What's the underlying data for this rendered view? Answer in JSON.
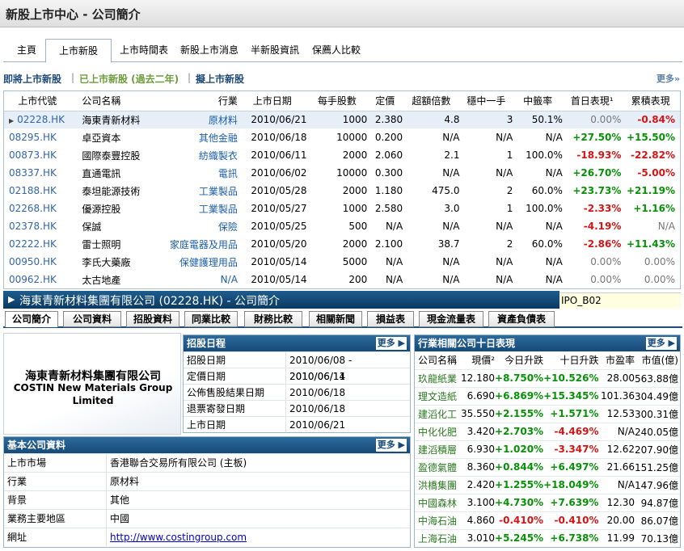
{
  "title": "新股上市中心 - 公司簡介",
  "nav_tabs": [
    "主頁",
    "上市新股",
    "上市時間表",
    "新股上市消息",
    "半新股資訊",
    "保薦人比較"
  ],
  "subnav": {
    "item1": "即將上市新股",
    "sep1": "|",
    "item2": "已上市新股 (過去二年)",
    "sep2": "|",
    "item3": "擬上市新股",
    "more": "更多»"
  },
  "list": {
    "headers": [
      "上市代號",
      "公司名稱",
      "行業",
      "上市日期",
      "每手股數",
      "定價",
      "超額倍數",
      "穩中一手",
      "中籤率",
      "首日表現¹",
      "累積表現"
    ],
    "rows": [
      [
        "02228.HK",
        "海東青新材料",
        "原材料",
        "2010/06/21",
        "1000",
        "2.380",
        "4.8",
        "3",
        "50.1%",
        "0.00%",
        "-0.84%"
      ],
      [
        "08295.HK",
        "卓亞資本",
        "其他金融",
        "2010/06/18",
        "10000",
        "0.200",
        "N/A",
        "N/A",
        "N/A",
        "+27.50%",
        "+15.50%"
      ],
      [
        "00873.HK",
        "國際泰豐控股",
        "紡織製衣",
        "2010/06/11",
        "2000",
        "2.060",
        "2.1",
        "1",
        "100.0%",
        "-18.93%",
        "-22.82%"
      ],
      [
        "08337.HK",
        "直通電訊",
        "電訊",
        "2010/06/02",
        "10000",
        "0.300",
        "N/A",
        "N/A",
        "N/A",
        "+26.70%",
        "-5.00%"
      ],
      [
        "02188.HK",
        "泰坦能源技術",
        "工業製品",
        "2010/05/28",
        "2000",
        "1.180",
        "475.0",
        "2",
        "60.0%",
        "+23.73%",
        "+21.19%"
      ],
      [
        "02268.HK",
        "優源控股",
        "工業製品",
        "2010/05/27",
        "1000",
        "2.580",
        "3.0",
        "1",
        "100.0%",
        "-2.33%",
        "+1.16%"
      ],
      [
        "02378.HK",
        "保誠",
        "保險",
        "2010/05/25",
        "500",
        "N/A",
        "N/A",
        "N/A",
        "N/A",
        "-4.19%",
        "N/A"
      ],
      [
        "02222.HK",
        "雷士照明",
        "家庭電器及用品",
        "2010/05/20",
        "2000",
        "2.100",
        "38.7",
        "2",
        "60.0%",
        "-2.86%",
        "+11.43%"
      ],
      [
        "00950.HK",
        "李氏大藥廠",
        "保健護理用品",
        "2010/05/14",
        "5000",
        "N/A",
        "N/A",
        "N/A",
        "N/A",
        "0.00%",
        "0.00%"
      ],
      [
        "00962.HK",
        "太古地產",
        "N/A",
        "2010/05/14",
        "200",
        "N/A",
        "N/A",
        "N/A",
        "N/A",
        "0.00%",
        "0.00%"
      ]
    ]
  },
  "company_header": {
    "arrow": "▶",
    "title": "海東青新材料集團有限公司 (02228.HK) - 公司簡介",
    "code": "IPO_B02"
  },
  "company_tabs": [
    "公司簡介",
    "公司資料",
    "招股資料",
    "同業比較",
    "財務比較",
    "相關新聞",
    "損益表",
    "現金流量表",
    "資產負債表"
  ],
  "logo": {
    "cn": "海東青新材料集團有限公司",
    "en1": "COSTIN New Materials Group",
    "en2": "Limited"
  },
  "ipo_schedule": {
    "title": "招股日程",
    "more": "更多 ▶",
    "rows": [
      [
        "招股日期",
        "2010/06/08 - 2010/06/11"
      ],
      [
        "定價日期",
        "2010/06/14"
      ],
      [
        "公佈售股結果日期",
        "2010/06/18"
      ],
      [
        "退票寄發日期",
        "2010/06/18"
      ],
      [
        "上市日期",
        "2010/06/21"
      ]
    ]
  },
  "basic_info": {
    "title": "基本公司資料",
    "more": "更多 ▶",
    "rows": [
      [
        "上市市場",
        "香港聯合交易所有限公司 (主板)"
      ],
      [
        "行業",
        "原材料"
      ],
      [
        "背景",
        "其他"
      ],
      [
        "業務主要地區",
        "中國"
      ],
      [
        "網址",
        "http://www.costingroup.com"
      ]
    ]
  },
  "peers": {
    "title": "行業相關公司十日表現",
    "more": "更多 ▶",
    "headers": [
      "公司名稱",
      "現價²",
      "今日升跌",
      "十日升跌",
      "市盈率",
      "市值(億)"
    ],
    "rows": [
      [
        "玖龍紙業",
        "12.180",
        "+8.750%",
        "+10.526%",
        "28.00",
        "563.88億"
      ],
      [
        "理文造紙",
        "6.690",
        "+6.869%",
        "+15.345%",
        "101.36",
        "304.49億"
      ],
      [
        "建滔化工",
        "35.550",
        "+2.155%",
        "+1.571%",
        "12.53",
        "300.31億"
      ],
      [
        "中化化肥",
        "3.420",
        "+2.703%",
        "-4.469%",
        "N/A",
        "240.05億"
      ],
      [
        "建滔積層",
        "6.930",
        "+1.020%",
        "-3.347%",
        "12.62",
        "207.90億"
      ],
      [
        "盈德氣體",
        "8.360",
        "+0.844%",
        "+6.497%",
        "21.66",
        "151.25億"
      ],
      [
        "洪橋集團",
        "2.420",
        "+1.255%",
        "+18.049%",
        "N/A",
        "147.96億"
      ],
      [
        "中國森林",
        "3.100",
        "+4.730%",
        "+7.639%",
        "12.30",
        "94.87億"
      ],
      [
        "中海石油",
        "4.860",
        "-0.410%",
        "-0.410%",
        "20.00",
        "86.07億"
      ],
      [
        "上海石油",
        "3.010",
        "+5.245%",
        "+6.738%",
        "11.99",
        "70.13億"
      ]
    ]
  },
  "colors": {
    "header_blue": "#164a77",
    "up": "#079107",
    "down": "#d41515",
    "link": "#3366aa"
  }
}
